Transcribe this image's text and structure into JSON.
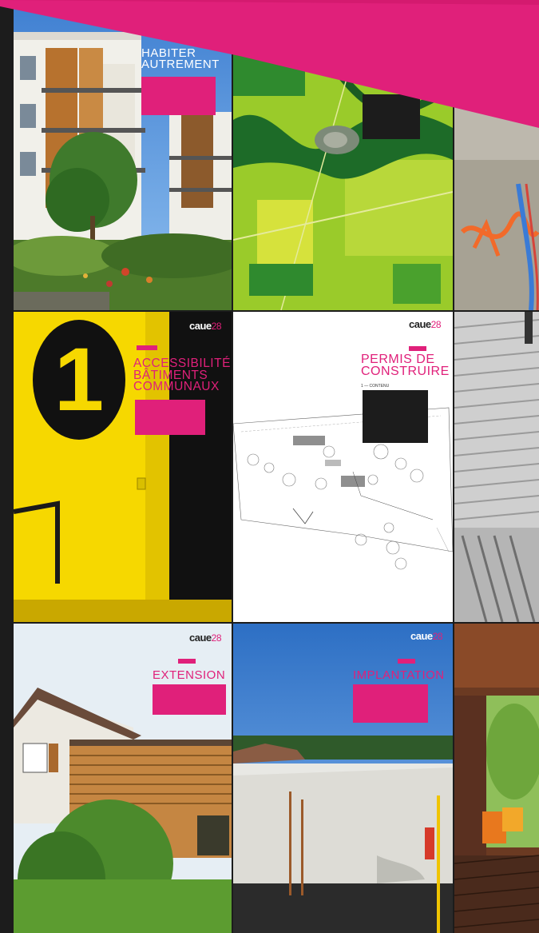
{
  "covers": {
    "habiter": {
      "title_line1": "HABITER",
      "title_line2": "AUTREMENT"
    },
    "aerial": {},
    "graffiti": {},
    "accessibilite": {
      "badge": "1",
      "logo_text": "caue",
      "logo_number": "28",
      "title_line1": "ACCESSIBILITÉ",
      "title_line2": "BÂTIMENTS",
      "title_line3": "COMMUNAUX"
    },
    "permis": {
      "logo_text": "caue",
      "logo_number": "28",
      "title_line1": "PERMIS DE",
      "title_line2": "CONSTRUIRE",
      "subtitle": "1 — CONTENU"
    },
    "extension": {
      "logo_text": "caue",
      "logo_number": "28",
      "title": "EXTENSION"
    },
    "implantation": {
      "logo_text": "caue",
      "logo_number": "28",
      "title": "IMPLANTATION"
    }
  },
  "colors": {
    "magenta": "#e0207a",
    "yellow": "#f2d400",
    "dark": "#1c1c1c"
  }
}
